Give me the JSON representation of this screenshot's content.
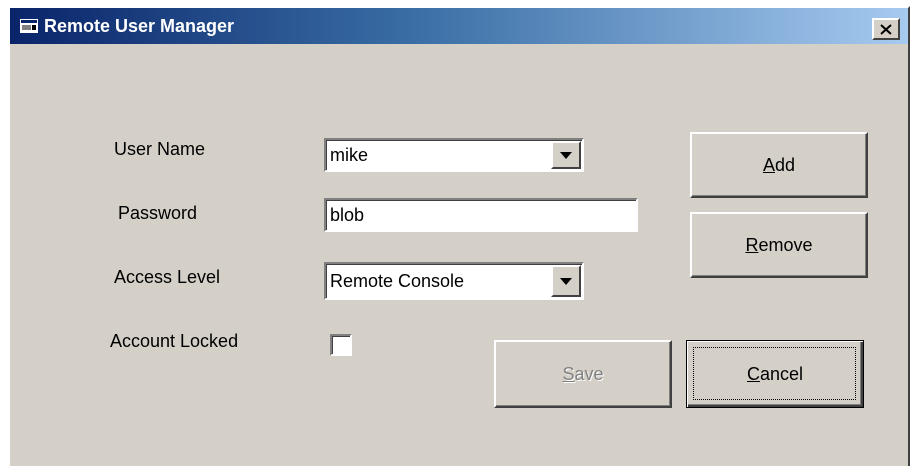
{
  "window": {
    "title": "Remote User Manager",
    "title_icon": "app-window-icon",
    "close_icon": "close-icon"
  },
  "form": {
    "user_name_label": "User Name",
    "user_name_value": "mike",
    "password_label": "Password",
    "password_value": "blob",
    "access_level_label": "Access Level",
    "access_level_value": "Remote Console",
    "account_locked_label": "Account Locked",
    "account_locked_checked": false
  },
  "buttons": {
    "add": {
      "accel": "A",
      "rest": "dd"
    },
    "remove": {
      "accel": "R",
      "rest": "emove"
    },
    "save": {
      "accel": "S",
      "rest": "ave",
      "enabled": false
    },
    "cancel": {
      "accel": "C",
      "rest": "ancel",
      "default": true
    }
  },
  "colors": {
    "face": "#d4d0c8",
    "title_start": "#0a246a",
    "title_end": "#a6caf0",
    "disabled_text": "#808080"
  }
}
